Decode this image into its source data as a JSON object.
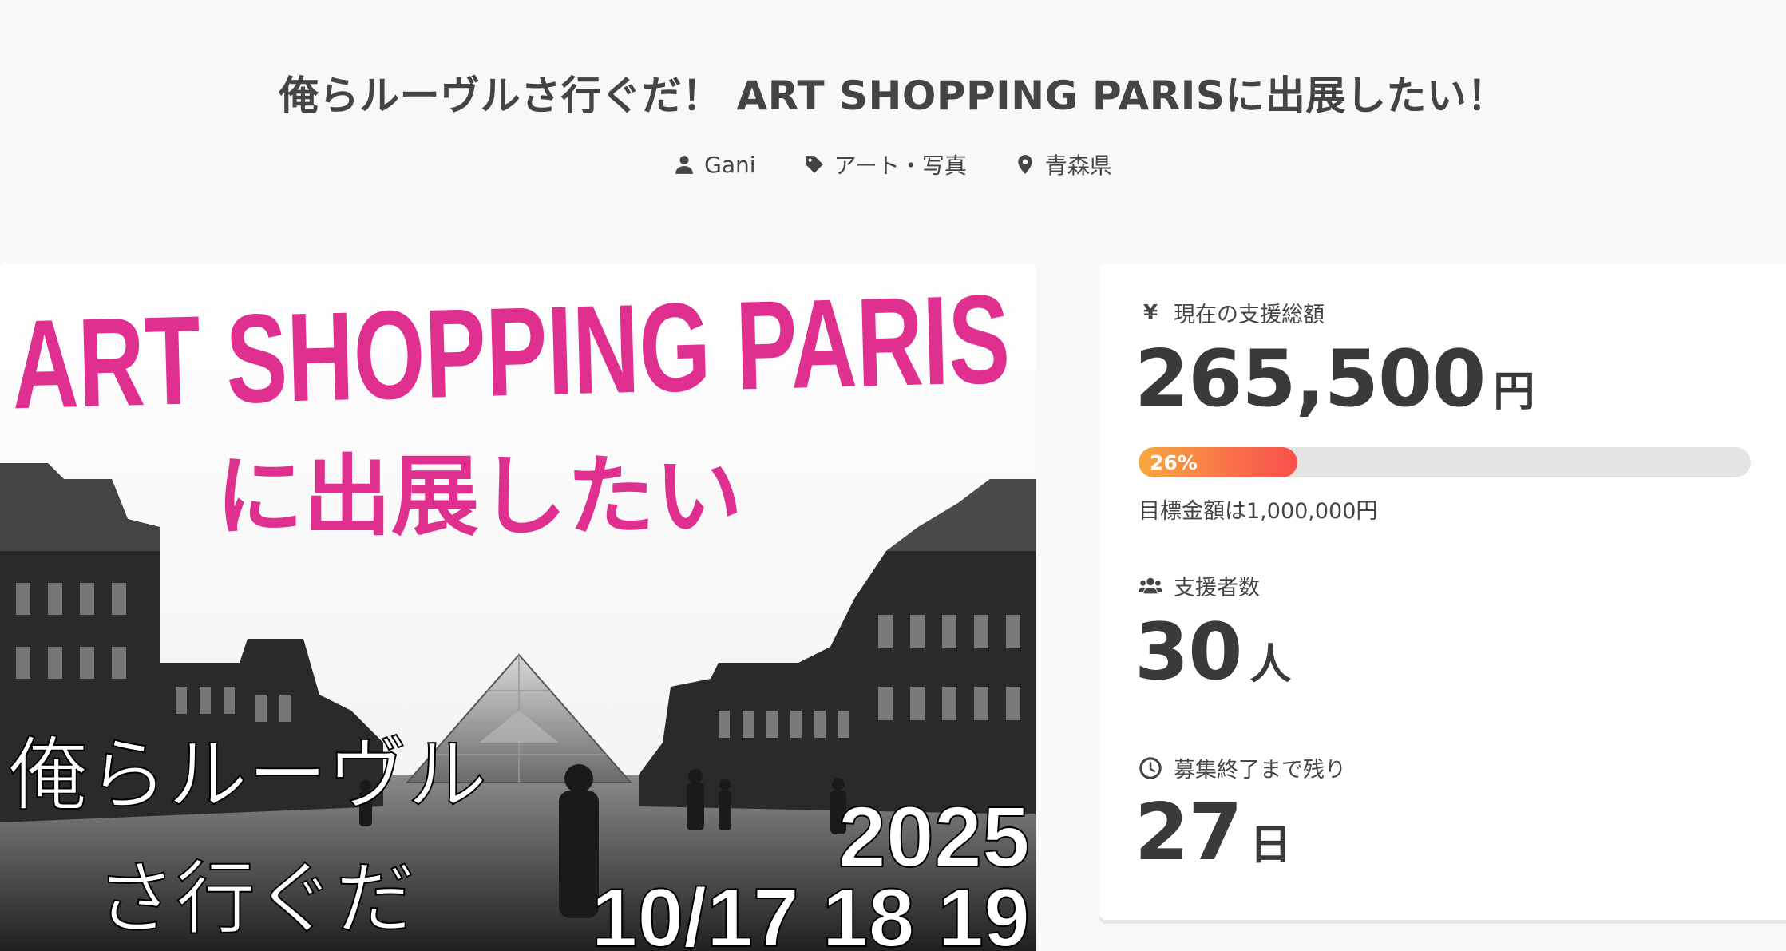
{
  "project": {
    "title": "俺らルーヴルさ行ぐだ！ ART SHOPPING PARISに出展したい！",
    "owner": "Gani",
    "category": "アート・写真",
    "location": "青森県"
  },
  "icons": {
    "owner": "user-icon",
    "category": "tag-icon",
    "location": "map-pin-icon",
    "amount": "yen-icon",
    "supporters": "users-icon",
    "remaining": "clock-icon"
  },
  "hero": {
    "headline_1": "ART SHOPPING PARIS",
    "headline_2": "に出展したい",
    "slogan_1": "俺らルーヴル",
    "slogan_2": "さ行ぐだ",
    "year": "2025",
    "dates": "10/17 18 19",
    "headline_color": "#e0308f"
  },
  "stats": {
    "amount_label": "現在の支援総額",
    "amount_symbol": "¥",
    "amount_value": "265,500",
    "amount_unit": "円",
    "progress_percent": 26,
    "progress_label": "26%",
    "goal_text": "目標金額は1,000,000円",
    "supporters_label": "支援者数",
    "supporters_value": "30",
    "supporters_unit": "人",
    "remaining_label": "募集終了まで残り",
    "remaining_value": "27",
    "remaining_unit": "日"
  },
  "colors": {
    "progress_start": "#f7a940",
    "progress_end": "#f8504b",
    "track": "#e4e4e4"
  }
}
